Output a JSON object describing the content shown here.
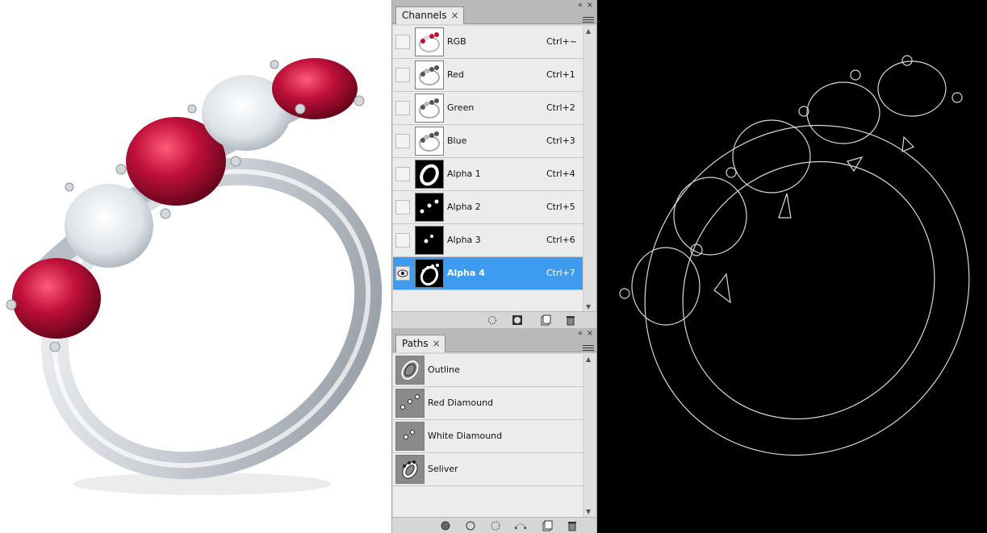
{
  "channels_panel": {
    "tab_label": "Channels",
    "tab_close": "×",
    "collapse_glyph": "«",
    "close_glyph": "×",
    "rows": [
      {
        "label": "RGB",
        "shortcut": "Ctrl+~",
        "thumb": "composite",
        "visible": false,
        "selected": false
      },
      {
        "label": "Red",
        "shortcut": "Ctrl+1",
        "thumb": "gray",
        "visible": false,
        "selected": false
      },
      {
        "label": "Green",
        "shortcut": "Ctrl+2",
        "thumb": "gray",
        "visible": false,
        "selected": false
      },
      {
        "label": "Blue",
        "shortcut": "Ctrl+3",
        "thumb": "gray",
        "visible": false,
        "selected": false
      },
      {
        "label": "Alpha 1",
        "shortcut": "Ctrl+4",
        "thumb": "mask-ring",
        "visible": false,
        "selected": false
      },
      {
        "label": "Alpha 2",
        "shortcut": "Ctrl+5",
        "thumb": "mask-dots",
        "visible": false,
        "selected": false
      },
      {
        "label": "Alpha 3",
        "shortcut": "Ctrl+6",
        "thumb": "mask-dots2",
        "visible": false,
        "selected": false
      },
      {
        "label": "Alpha 4",
        "shortcut": "Ctrl+7",
        "thumb": "mask-ring-stones",
        "visible": true,
        "selected": true
      }
    ],
    "footer_icons": [
      "load-selection-icon",
      "save-selection-icon",
      "new-channel-icon",
      "delete-channel-icon"
    ]
  },
  "paths_panel": {
    "tab_label": "Paths",
    "tab_close": "×",
    "collapse_glyph": "«",
    "close_glyph": "×",
    "rows": [
      {
        "label": "Outline",
        "thumb": "ring-outline"
      },
      {
        "label": "Red Diamound",
        "thumb": "red-dots"
      },
      {
        "label": "White Diamound",
        "thumb": "white-dots"
      },
      {
        "label": "Seliver",
        "thumb": "band"
      }
    ],
    "footer_icons": [
      "fill-path-icon",
      "stroke-path-icon",
      "load-path-selection-icon",
      "make-work-path-icon",
      "new-path-icon",
      "delete-path-icon"
    ]
  },
  "colors": {
    "selection": "#3d9cf0",
    "ruby": "#c0103a",
    "panel_bg": "#d6d6d6",
    "canvas_bg": "#000000"
  }
}
